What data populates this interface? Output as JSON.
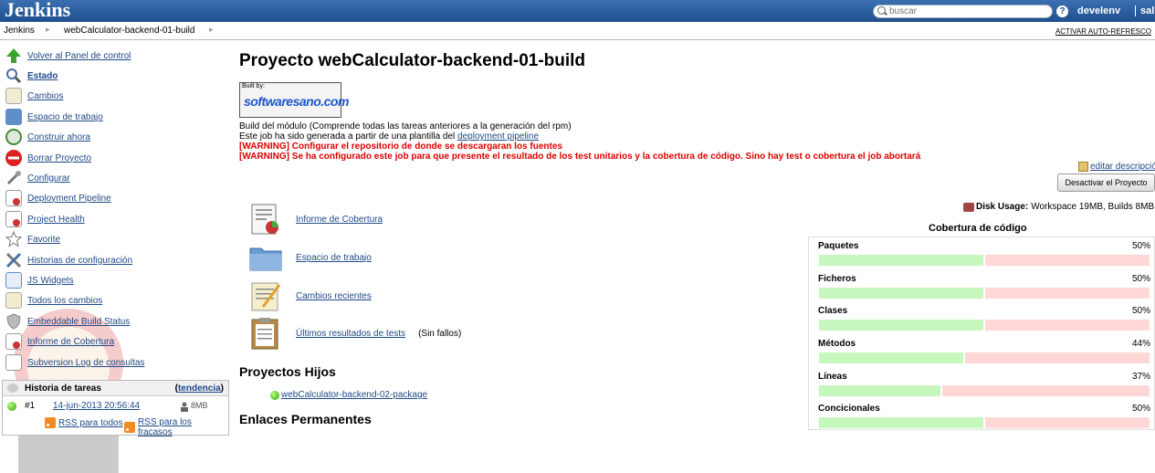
{
  "header": {
    "logo": "Jenkins",
    "search_placeholder": "buscar",
    "help": "?",
    "user": "develenv",
    "logout": "sali"
  },
  "breadcrumb": {
    "items": [
      "Jenkins",
      "webCalculator-backend-01-build"
    ],
    "auto_refresh": "ACTIVAR AUTO-REFRESCO"
  },
  "sidebar": {
    "items": [
      {
        "label": "Volver al Panel de control",
        "icon": "up-arrow-icon"
      },
      {
        "label": "Estado",
        "icon": "search-icon"
      },
      {
        "label": "Cambios",
        "icon": "notepad-icon"
      },
      {
        "label": "Espacio de trabajo",
        "icon": "folder-icon"
      },
      {
        "label": "Construir ahora",
        "icon": "clock-icon"
      },
      {
        "label": "Borrar Proyecto",
        "icon": "no-entry-icon"
      },
      {
        "label": "Configurar",
        "icon": "wrench-icon"
      },
      {
        "label": "Deployment Pipeline",
        "icon": "document-icon"
      },
      {
        "label": "Project Health",
        "icon": "document-icon"
      },
      {
        "label": "Favorite",
        "icon": "star-icon"
      },
      {
        "label": "Historias de configuración",
        "icon": "tools-icon"
      },
      {
        "label": "JS Widgets",
        "icon": "widget-icon"
      },
      {
        "label": "Todos los cambios",
        "icon": "notepad-icon"
      },
      {
        "label": "Embeddable Build Status",
        "icon": "shield-icon"
      },
      {
        "label": "Informe de Cobertura",
        "icon": "document-icon"
      },
      {
        "label": "Subversion Log de consultas",
        "icon": "document-icon"
      }
    ]
  },
  "history": {
    "title": "Historia de tareas",
    "trend_open": "(",
    "trend": "tendencia",
    "trend_close": ")",
    "build_number": "#1",
    "build_date": "14-jun-2013 20:56:44",
    "build_size": "8MB",
    "rss_all": "RSS para todos",
    "rss_failures": "RSS para los fracasos"
  },
  "main": {
    "title": "Proyecto webCalculator-backend-01-build",
    "built_by_small": "Built by:",
    "built_by_logo": "softwaresano.com",
    "description_line1": "Build del módulo (Comprende todas las tareas anteriores a la generación del rpm)",
    "description_line2_prefix": "Este job ha sido generada a partir de una plantilla del ",
    "description_line2_link": "deployment pipeline",
    "warning1": "[WARNING] Configurar el repositorio de donde se descargaran los fuentes",
    "warning2": "[WARNING] Se ha configurado este job para que presente el resultado de los test unitarios y la cobertura de código. Sino hay test o cobertura el job abortará",
    "edit_description": "editar descripción",
    "disable_button": "Desactivar el Proyecto",
    "disk_usage_label": "Disk Usage:",
    "disk_usage_value": "Workspace 19MB, Builds 8MB",
    "links": [
      {
        "label": "Informe de Cobertura",
        "icon": "coverage-report-icon",
        "extra": ""
      },
      {
        "label": "Espacio de trabajo",
        "icon": "folder-icon",
        "extra": ""
      },
      {
        "label": "Cambios recientes",
        "icon": "notepad-icon",
        "extra": ""
      },
      {
        "label": "Últimos resultados de tests",
        "icon": "clipboard-icon",
        "extra": "(Sin fallos)"
      }
    ],
    "child_projects_title": "Proyectos Hijos",
    "child_project": "webCalculator-backend-02-package",
    "permalinks_title": "Enlaces Permanentes"
  },
  "coverage": {
    "title": "Cobertura de código",
    "rows": [
      {
        "name": "Paquetes",
        "percent": "50%",
        "value": 0.5
      },
      {
        "name": "Ficheros",
        "percent": "50%",
        "value": 0.5
      },
      {
        "name": "Clases",
        "percent": "50%",
        "value": 0.5
      },
      {
        "name": "Métodos",
        "percent": "44%",
        "value": 0.44
      },
      {
        "name": "Líneas",
        "percent": "37%",
        "value": 0.37
      },
      {
        "name": "Concicionales",
        "percent": "50%",
        "value": 0.5
      }
    ]
  }
}
